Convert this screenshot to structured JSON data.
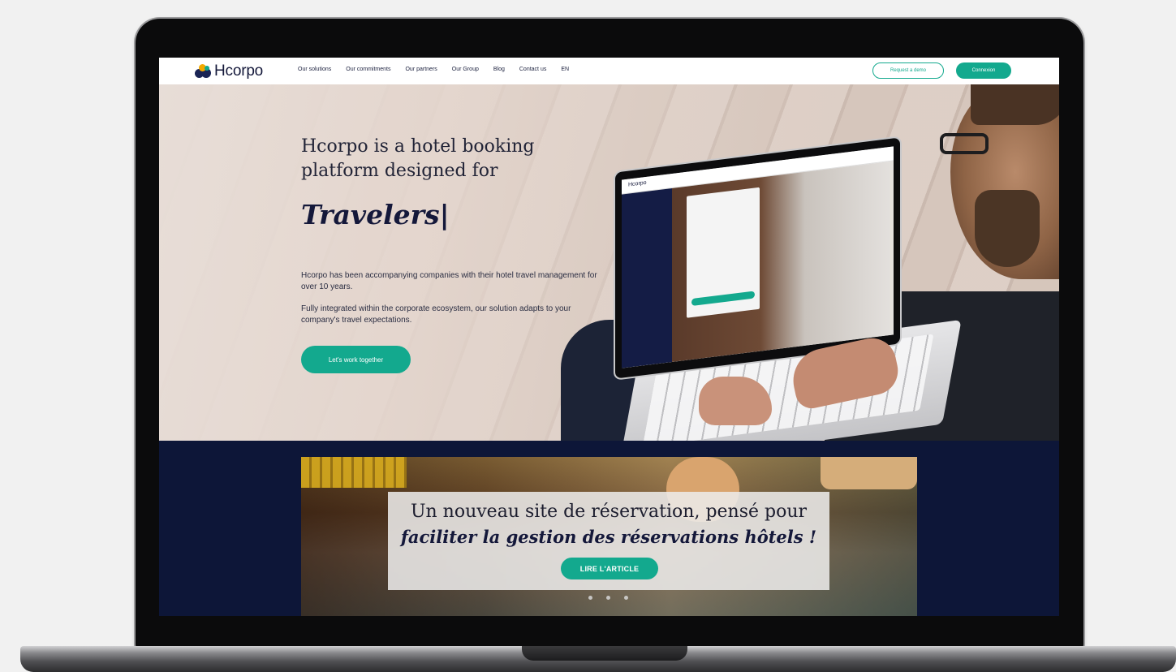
{
  "brand": {
    "name": "Hcorpo",
    "colors": {
      "accent": "#13a98e",
      "navy": "#0d1638",
      "logo_yellow": "#f2a900"
    }
  },
  "nav": {
    "items": [
      {
        "label": "Our solutions"
      },
      {
        "label": "Our commitments"
      },
      {
        "label": "Our partners"
      },
      {
        "label": "Our Group"
      },
      {
        "label": "Blog"
      },
      {
        "label": "Contact us"
      },
      {
        "label": "EN"
      }
    ],
    "demo_label": "Request a demo",
    "login_label": "Connexion"
  },
  "hero": {
    "title": "Hcorpo is a hotel booking platform designed for",
    "accent": "Travelers|",
    "paragraph1": "Hcorpo has been accompanying companies with their hotel travel management for over 10 years.",
    "paragraph2": "Fully integrated within the corporate ecosystem, our solution adapts to your company's travel expectations.",
    "cta_label": "Let's work together"
  },
  "banner": {
    "line1": "Un nouveau site de réservation, pensé pour",
    "line2": "faciliter la gestion des réservations hôtels !",
    "cta_label": "LIRE L'ARTICLE",
    "slides": 3
  },
  "icons": [
    "hcorpo-logo-icon",
    "carousel-dot"
  ]
}
